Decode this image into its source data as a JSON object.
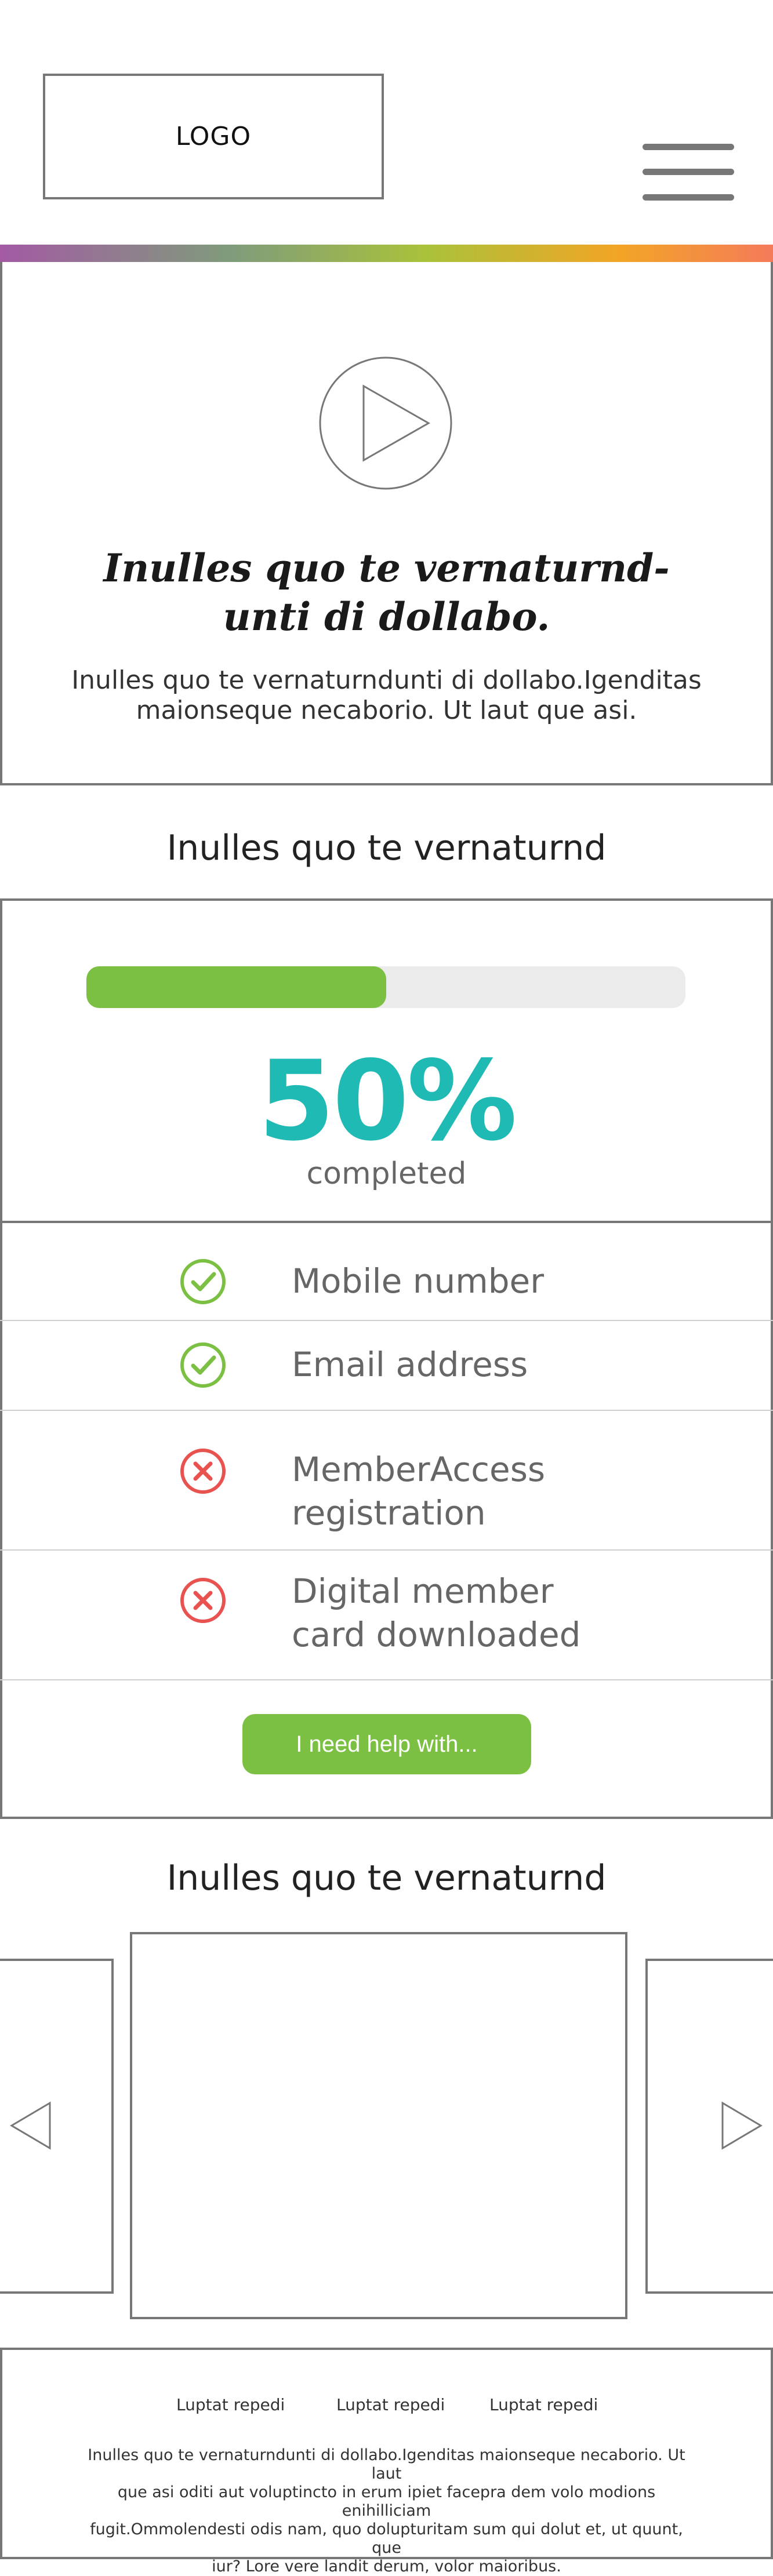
{
  "header": {
    "logo_text": "LOGO",
    "menu_icon": "hamburger-menu-icon"
  },
  "hero": {
    "play_icon": "play-icon",
    "title_line1": "Inulles quo te vernaturnd-",
    "title_line2": "unti di dollabo.",
    "text_line1": "Inulles quo te vernaturndunti di dollabo.Igenditas",
    "text_line2": "maionseque necaborio. Ut laut que asi."
  },
  "progress_section": {
    "title": "Inulles quo te vernaturnd",
    "progress_fraction": 0.5,
    "percent_text": "50%",
    "completed_label": "completed",
    "items": [
      {
        "label_line1": "Mobile number",
        "label_line2": "",
        "status": "done",
        "icon": "check-circle-icon"
      },
      {
        "label_line1": "Email address",
        "label_line2": "",
        "status": "done",
        "icon": "check-circle-icon"
      },
      {
        "label_line1": "MemberAccess",
        "label_line2": "registration",
        "status": "not-done",
        "icon": "x-circle-icon"
      },
      {
        "label_line1": "Digital member",
        "label_line2": "card downloaded",
        "status": "not-done",
        "icon": "x-circle-icon"
      }
    ],
    "help_button": "I need help with..."
  },
  "carousel": {
    "title": "Inulles quo te vernaturnd",
    "prev_icon": "arrow-left-icon",
    "next_icon": "arrow-right-icon"
  },
  "footer": {
    "links": [
      "Luptat repedi",
      "Luptat repedi",
      "Luptat repedi"
    ],
    "text_line1": "Inulles quo te vernaturndunti di dollabo.Igenditas maionseque necaborio. Ut laut",
    "text_line2": "que asi oditi aut voluptincto in erum ipiet facepra dem volo modions enihilliciam",
    "text_line3": "fugit.Ommolendesti odis nam, quo dolupturitam sum qui dolut et, ut quunt, que",
    "text_line4": "iur? Lore vere landit derum, volor maioribus."
  },
  "colors": {
    "accent_green": "#7bc043",
    "percent_teal": "#1fbab4",
    "error_red": "#e8524f",
    "border_gray": "#777777"
  }
}
